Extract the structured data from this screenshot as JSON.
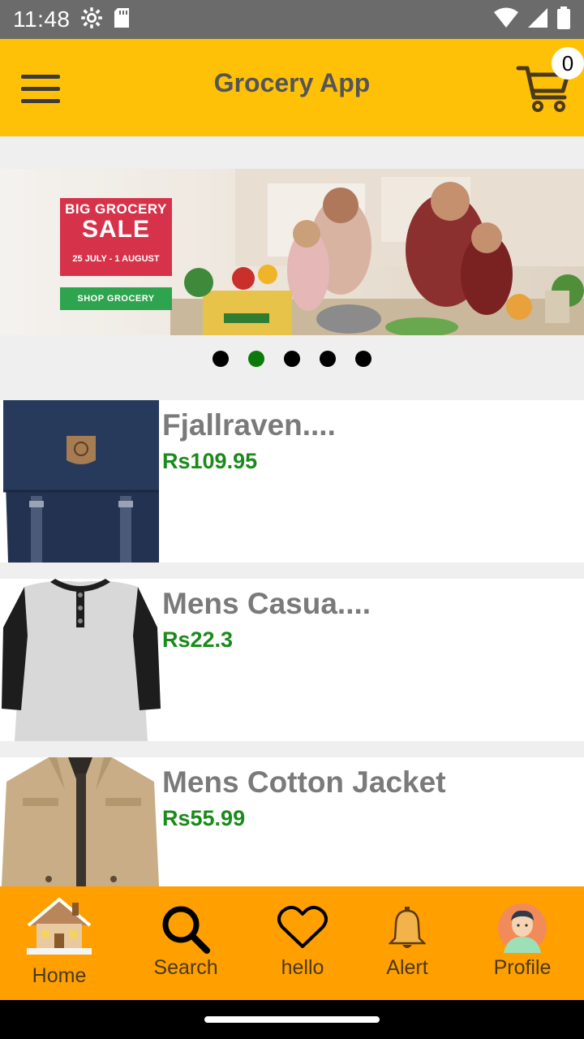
{
  "status_bar": {
    "time": "11:48"
  },
  "app_bar": {
    "title": "Grocery App",
    "cart_count": "0"
  },
  "banner": {
    "line1": "BIG GROCERY",
    "line2": "SALE",
    "dates": "25 JULY - 1 AUGUST",
    "cta": "SHOP GROCERY",
    "box_label": "noon GROCERY"
  },
  "carousel": {
    "slides": 5,
    "active_index": 1
  },
  "products": [
    {
      "name": "Fjallraven....",
      "price": "Rs109.95"
    },
    {
      "name": "Mens Casua....",
      "price": "Rs22.3"
    },
    {
      "name": "Mens Cotton Jacket",
      "price": "Rs55.99"
    }
  ],
  "bottom_nav": [
    {
      "label": "Home",
      "icon": "house-icon"
    },
    {
      "label": "Search",
      "icon": "search-icon"
    },
    {
      "label": "hello",
      "icon": "heart-icon"
    },
    {
      "label": "Alert",
      "icon": "bell-icon"
    },
    {
      "label": "Profile",
      "icon": "avatar-icon"
    }
  ],
  "colors": {
    "app_bar": "#ffc107",
    "bottom_nav": "#ff9f00",
    "price": "#1a8a1a",
    "active_dot": "#0b7a0b"
  }
}
